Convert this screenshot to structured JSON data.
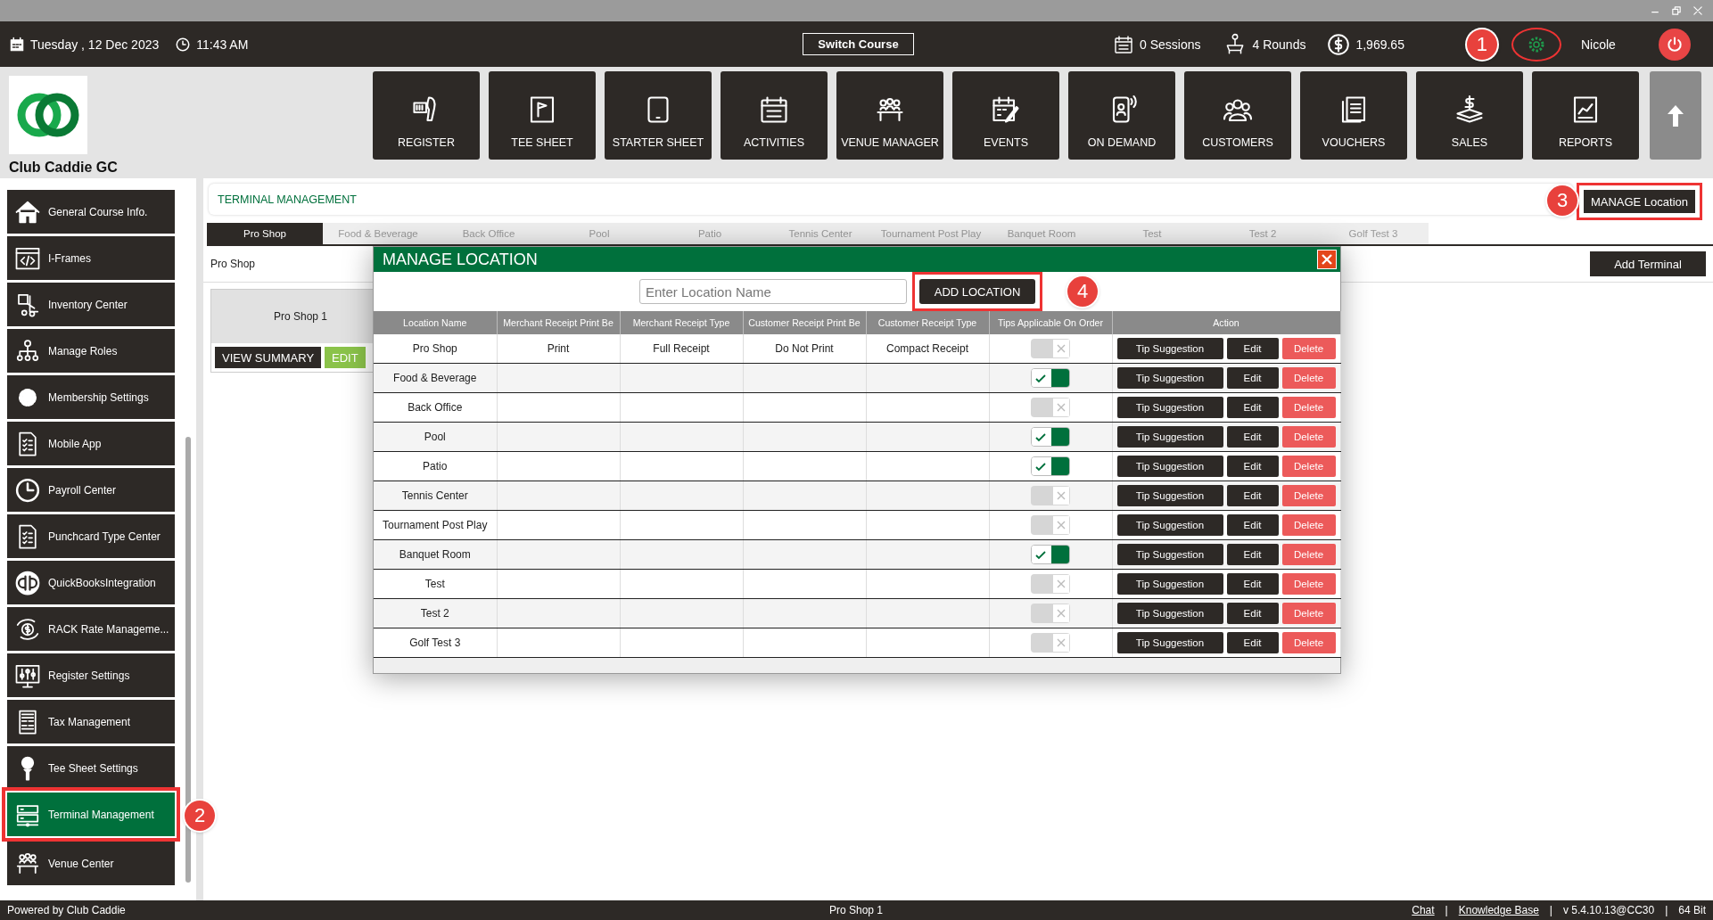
{
  "top_bar": {
    "date": "Tuesday ,  12 Dec 2023",
    "time": "11:43 AM",
    "switch_course": "Switch Course",
    "sessions": "0 Sessions",
    "rounds": "4 Rounds",
    "balance": "1,969.65",
    "settings": {
      "highlighted": true,
      "callout": "1"
    },
    "user": "Nicole"
  },
  "logo": {
    "name": "Club Caddie GC"
  },
  "nav": [
    {
      "label": "REGISTER"
    },
    {
      "label": "TEE SHEET"
    },
    {
      "label": "STARTER SHEET"
    },
    {
      "label": "ACTIVITIES"
    },
    {
      "label": "VENUE MANAGER"
    },
    {
      "label": "EVENTS"
    },
    {
      "label": "ON DEMAND"
    },
    {
      "label": "CUSTOMERS"
    },
    {
      "label": "VOUCHERS"
    },
    {
      "label": "SALES"
    },
    {
      "label": "REPORTS"
    }
  ],
  "sidebar": {
    "items": [
      {
        "label": "General Course Info.",
        "selected": false,
        "highlighted": false
      },
      {
        "label": "I-Frames",
        "selected": false,
        "highlighted": false
      },
      {
        "label": "Inventory Center",
        "selected": false,
        "highlighted": false
      },
      {
        "label": "Manage Roles",
        "selected": false,
        "highlighted": false
      },
      {
        "label": "Membership Settings",
        "selected": false,
        "highlighted": false
      },
      {
        "label": "Mobile App",
        "selected": false,
        "highlighted": false
      },
      {
        "label": "Payroll Center",
        "selected": false,
        "highlighted": false
      },
      {
        "label": "Punchcard Type Center",
        "selected": false,
        "highlighted": false
      },
      {
        "label": "QuickBooksIntegration",
        "selected": false,
        "highlighted": false
      },
      {
        "label": "RACK Rate Manageme...",
        "selected": false,
        "highlighted": false
      },
      {
        "label": "Register Settings",
        "selected": false,
        "highlighted": false
      },
      {
        "label": "Tax Management",
        "selected": false,
        "highlighted": false
      },
      {
        "label": "Tee Sheet Settings",
        "selected": false,
        "highlighted": false
      },
      {
        "label": "Terminal Management",
        "selected": true,
        "highlighted": true,
        "callout": "2"
      },
      {
        "label": "Venue Center",
        "selected": false,
        "highlighted": false
      }
    ]
  },
  "page": {
    "title": "TERMINAL MANAGEMENT",
    "manage_button": {
      "label": "MANAGE Location",
      "highlighted": true,
      "callout": "3"
    },
    "tabs": [
      {
        "label": "Pro Shop",
        "selected": true
      },
      {
        "label": "Food & Beverage",
        "selected": false
      },
      {
        "label": "Back Office",
        "selected": false
      },
      {
        "label": "Pool",
        "selected": false
      },
      {
        "label": "Patio",
        "selected": false
      },
      {
        "label": "Tennis Center",
        "selected": false
      },
      {
        "label": "Tournament Post Play",
        "selected": false
      },
      {
        "label": "Banquet Room",
        "selected": false
      },
      {
        "label": "Test",
        "selected": false
      },
      {
        "label": "Test 2",
        "selected": false
      },
      {
        "label": "Golf Test 3",
        "selected": false
      }
    ],
    "section_label": "Pro Shop",
    "add_terminal": "Add Terminal",
    "terminals": [
      {
        "name": "Pro Shop 1",
        "view_button": "VIEW SUMMARY",
        "edit_button": "EDIT"
      }
    ]
  },
  "modal": {
    "title": "MANAGE LOCATION",
    "search": {
      "placeholder": "Enter Location Name"
    },
    "add_button": {
      "label": "ADD LOCATION",
      "highlighted": true,
      "callout": "4"
    },
    "columns": [
      "Location Name",
      "Merchant Receipt Print Be",
      "Merchant Receipt Type",
      "Customer Receipt Print Be",
      "Customer Receipt Type",
      "Tips Applicable On Order",
      "Action"
    ],
    "rows": [
      {
        "location": "Pro Shop",
        "merchant_print": "Print",
        "merchant_type": "Full Receipt",
        "customer_print": "Do Not Print",
        "customer_type": "Compact Receipt",
        "tips": false,
        "actions": [
          "Tip Suggestion",
          "Edit",
          "Delete"
        ]
      },
      {
        "location": "Food & Beverage",
        "tips": true,
        "actions": [
          "Tip Suggestion",
          "Edit",
          "Delete"
        ]
      },
      {
        "location": "Back Office",
        "tips": false,
        "actions": [
          "Tip Suggestion",
          "Edit",
          "Delete"
        ]
      },
      {
        "location": "Pool",
        "tips": true,
        "actions": [
          "Tip Suggestion",
          "Edit",
          "Delete"
        ]
      },
      {
        "location": "Patio",
        "tips": true,
        "actions": [
          "Tip Suggestion",
          "Edit",
          "Delete"
        ]
      },
      {
        "location": "Tennis Center",
        "tips": false,
        "actions": [
          "Tip Suggestion",
          "Edit",
          "Delete"
        ]
      },
      {
        "location": "Tournament Post Play",
        "tips": false,
        "actions": [
          "Tip Suggestion",
          "Edit",
          "Delete"
        ]
      },
      {
        "location": "Banquet Room",
        "tips": true,
        "actions": [
          "Tip Suggestion",
          "Edit",
          "Delete"
        ]
      },
      {
        "location": "Test",
        "tips": false,
        "actions": [
          "Tip Suggestion",
          "Edit",
          "Delete"
        ]
      },
      {
        "location": "Test 2",
        "tips": false,
        "actions": [
          "Tip Suggestion",
          "Edit",
          "Delete"
        ]
      },
      {
        "location": "Golf Test 3",
        "tips": false,
        "actions": [
          "Tip Suggestion",
          "Edit",
          "Delete"
        ]
      }
    ]
  },
  "status_bar": {
    "left": "Powered by Club Caddie",
    "center": "Pro Shop 1",
    "right": [
      {
        "kind": "link",
        "text": "Chat"
      },
      {
        "kind": "separator",
        "text": "|"
      },
      {
        "kind": "link",
        "text": "Knowledge Base"
      },
      {
        "kind": "separator",
        "text": "|"
      },
      {
        "kind": "text",
        "text": "v 5.4.10.13@CC30"
      },
      {
        "kind": "separator",
        "text": "|"
      },
      {
        "kind": "text",
        "text": "64 Bit"
      }
    ]
  }
}
